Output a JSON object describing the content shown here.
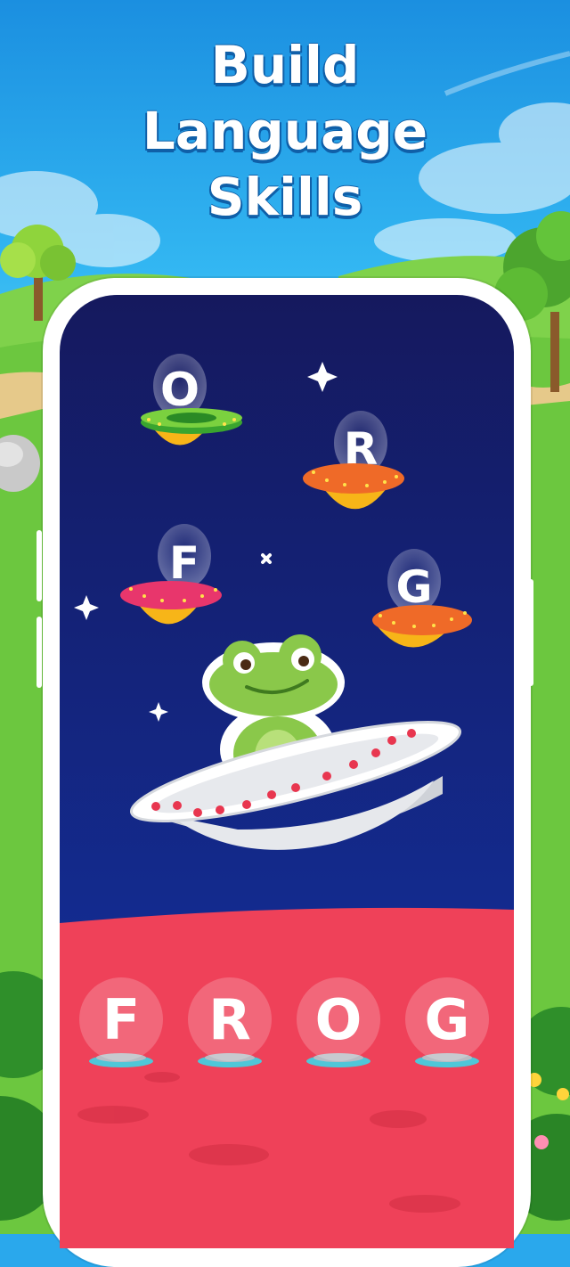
{
  "headline": {
    "line1": "Build",
    "line2": "Language",
    "line3": "Skills"
  },
  "game": {
    "floating_letters": [
      "O",
      "R",
      "F",
      "G"
    ],
    "answer_slots": [
      "F",
      "R",
      "O",
      "G"
    ],
    "character": "frog-icon",
    "vehicle": "ufo-icon"
  },
  "colors": {
    "space_top": "#15195e",
    "space_bottom": "#1234a8",
    "planet": "#ef4159",
    "headline_outline": "#0f5fa8"
  }
}
